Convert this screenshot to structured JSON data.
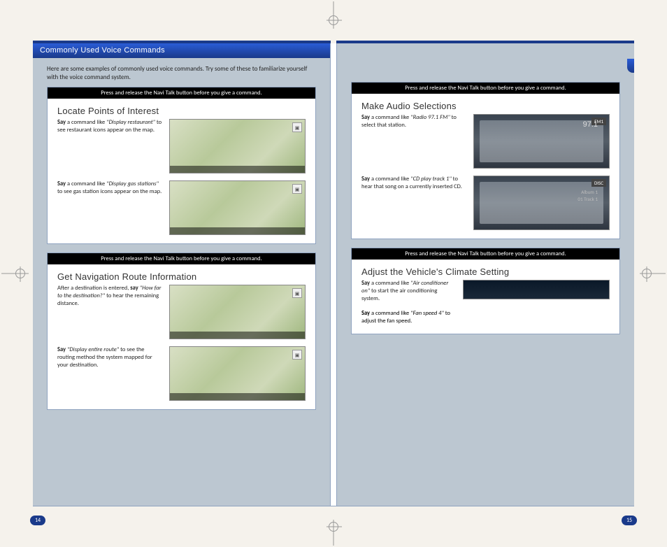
{
  "header": {
    "title": "Commonly Used Voice Commands"
  },
  "intro": "Here are some examples of commonly used voice commands. Try some of these to familiarize yourself with the voice command system.",
  "navi_instruction": "Press and release the Navi Talk button before you give a command.",
  "sections": {
    "poi": {
      "title": "Locate Points of Interest",
      "item1_pre": "Say",
      "item1_mid": " a command like ",
      "item1_cmd": "\"Display restaurant\"",
      "item1_post": " to see restaurant icons appear on the map.",
      "item2_pre": "Say",
      "item2_mid": " a command like ",
      "item2_cmd": "\"Display gas stations\"",
      "item2_post": " to see gas station icons appear on the map."
    },
    "route": {
      "title": "Get Navigation Route Information",
      "item1_pre": "After a destination is entered, ",
      "item1_bold": "say",
      "item1_cmd": " \"How far to the destination?\"",
      "item1_post": " to hear the remaining distance.",
      "item2_pre": "Say",
      "item2_cmd": " \"Display entire route\"",
      "item2_post": " to see the routing method the system mapped for your destination."
    },
    "audio": {
      "title": "Make Audio Selections",
      "item1_pre": "Say",
      "item1_mid": " a command like ",
      "item1_cmd": "\"Radio 97.1 FM\"",
      "item1_post": " to select that station.",
      "freq": "97.1",
      "fm_label": "FM1",
      "item2_pre": "Say",
      "item2_mid": " a command like ",
      "item2_cmd": "\"CD play track 1\"",
      "item2_post": " to hear that song on a currently inserted CD.",
      "disc_label": "DISC",
      "album_label": "Album 1",
      "track_label": "01 Track 1"
    },
    "climate": {
      "title": "Adjust the Vehicle's Climate Setting",
      "item1_pre": "Say",
      "item1_mid": " a command like ",
      "item1_cmd": "\"Air conditioner on\"",
      "item1_post": " to start the air conditioning system.",
      "item2_pre": "Say",
      "item2_mid": " a command like ",
      "item2_cmd": "\"Fan speed 4\"",
      "item2_post": " to adjust the fan speed."
    }
  },
  "page_numbers": {
    "left": "14",
    "right": "15"
  }
}
